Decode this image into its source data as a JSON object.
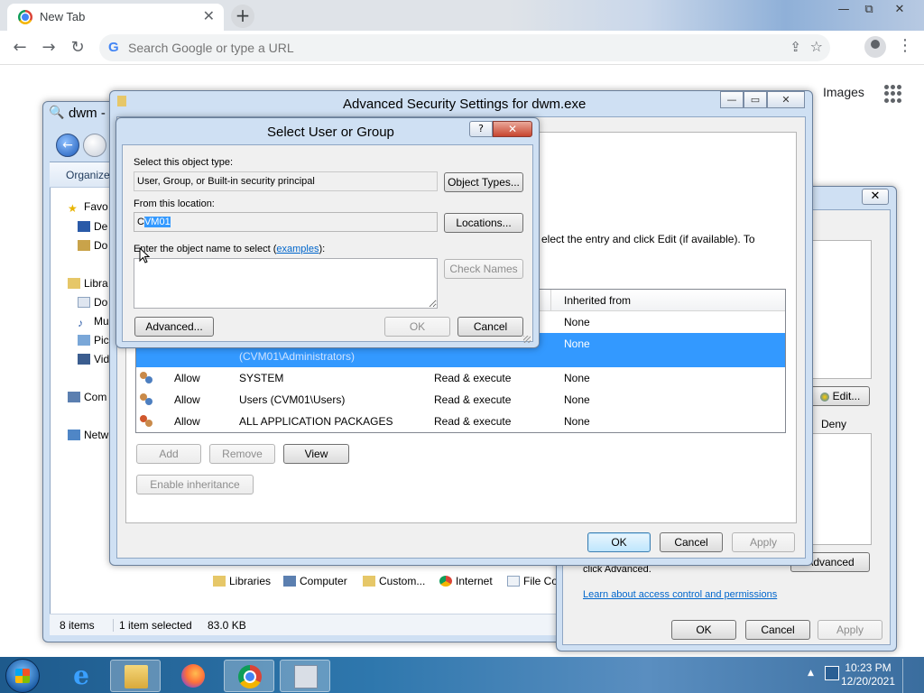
{
  "chrome": {
    "tab_title": "New Tab",
    "tab_close": "✕",
    "new_tab": "+",
    "window_controls": {
      "minimize": "—",
      "restore": "⧉",
      "close": "✕"
    },
    "nav": {
      "back": "←",
      "forward": "→",
      "reload": "↻"
    },
    "omnibox_placeholder": "Search Google or type a URL",
    "images_link": "Images",
    "kebab": "⋮"
  },
  "explorer": {
    "title": "dwm -",
    "organize": "Organize",
    "nav_items": [
      "Favo",
      "De",
      "Do",
      "Libra",
      "Do",
      "Mu",
      "Pic",
      "Vid",
      "Com",
      "Netw"
    ],
    "bottom_bar": [
      "Libraries",
      "Computer",
      "Custom...",
      "Internet",
      "File Co"
    ],
    "status": {
      "items": "8 items",
      "selected": "1 item selected",
      "size": "83.0 KB"
    }
  },
  "props": {
    "close": "✕",
    "edit_button": "Edit...",
    "deny_label": "Deny",
    "advanced_button": "Advanced",
    "advanced_text": "click Advanced.",
    "learn_link": "Learn about access control and permissions",
    "ok": "OK",
    "cancel": "Cancel",
    "apply": "Apply"
  },
  "adv": {
    "title": "Advanced Security Settings for dwm.exe",
    "instruction": "elect the entry and click Edit (if available). To",
    "table": {
      "header_inherited": "Inherited from",
      "rows": [
        {
          "type": "",
          "principal": "",
          "access": "",
          "inherited": "None",
          "selected": false
        },
        {
          "type": "",
          "principal": "(CVM01\\Administrators)",
          "access": "",
          "inherited": "None",
          "selected": true
        },
        {
          "type": "Allow",
          "principal": "SYSTEM",
          "access": "Read & execute",
          "inherited": "None",
          "selected": false
        },
        {
          "type": "Allow",
          "principal": "Users (CVM01\\Users)",
          "access": "Read & execute",
          "inherited": "None",
          "selected": false
        },
        {
          "type": "Allow",
          "principal": "ALL APPLICATION PACKAGES",
          "access": "Read & execute",
          "inherited": "None",
          "selected": false
        }
      ]
    },
    "add": "Add",
    "remove": "Remove",
    "view": "View",
    "enable_inheritance": "Enable inheritance",
    "ok": "OK",
    "cancel": "Cancel",
    "apply": "Apply"
  },
  "sug": {
    "title": "Select User or Group",
    "help": "?",
    "close": "✕",
    "object_type_label": "Select this object type:",
    "object_type_value": "User, Group, or Built-in security principal",
    "object_types_button": "Object Types...",
    "location_label": "From this location:",
    "location_prefix": "C",
    "location_selected": "VM01",
    "locations_button": "Locations...",
    "name_label_prefix": "Enter the object name to select (",
    "name_label_link": "examples",
    "name_label_suffix": "):",
    "check_names": "Check Names",
    "advanced": "Advanced...",
    "ok": "OK",
    "cancel": "Cancel"
  },
  "taskbar": {
    "time": "10:23 PM",
    "date": "12/20/2021",
    "tray_arrow": "▲"
  }
}
